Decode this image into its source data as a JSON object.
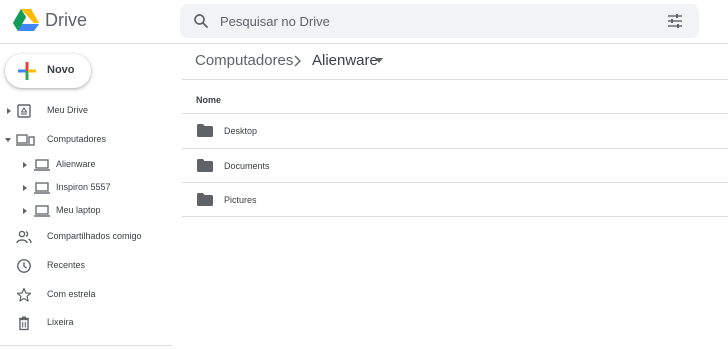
{
  "header": {
    "brand": "Drive",
    "search_placeholder": "Pesquisar no Drive",
    "logo_icon": "google-drive-logo",
    "search_icon": "search-icon",
    "options_icon": "tune-icon"
  },
  "new_button": {
    "label": "Novo",
    "icon": "plus-icon"
  },
  "sidebar": {
    "items": [
      {
        "label": "Meu Drive",
        "icon": "my-drive-icon",
        "expandable": true
      },
      {
        "label": "Computadores",
        "icon": "computers-icon",
        "expandable": true,
        "expanded": true
      },
      {
        "label": "Alienware",
        "icon": "laptop-icon",
        "expandable": true,
        "level": 2
      },
      {
        "label": "Inspiron 5557",
        "icon": "laptop-icon",
        "expandable": true,
        "level": 2
      },
      {
        "label": "Meu laptop",
        "icon": "laptop-icon",
        "expandable": true,
        "level": 2
      },
      {
        "label": "Compartilhados comigo",
        "icon": "shared-people-icon"
      },
      {
        "label": "Recentes",
        "icon": "clock-icon"
      },
      {
        "label": "Com estrela",
        "icon": "star-icon"
      },
      {
        "label": "Lixeira",
        "icon": "trash-icon"
      }
    ]
  },
  "breadcrumb": {
    "root": "Computadores",
    "current": "Alienware"
  },
  "file_list": {
    "column_name": "Nome",
    "rows": [
      {
        "name": "Desktop",
        "icon": "folder-icon"
      },
      {
        "name": "Documents",
        "icon": "folder-icon"
      },
      {
        "name": "Pictures",
        "icon": "folder-icon"
      }
    ]
  },
  "colors": {
    "icon_gray": "#5f6368",
    "text": "#3c4043",
    "divider": "#e0e0e0",
    "search_bg": "#f1f3f4"
  }
}
